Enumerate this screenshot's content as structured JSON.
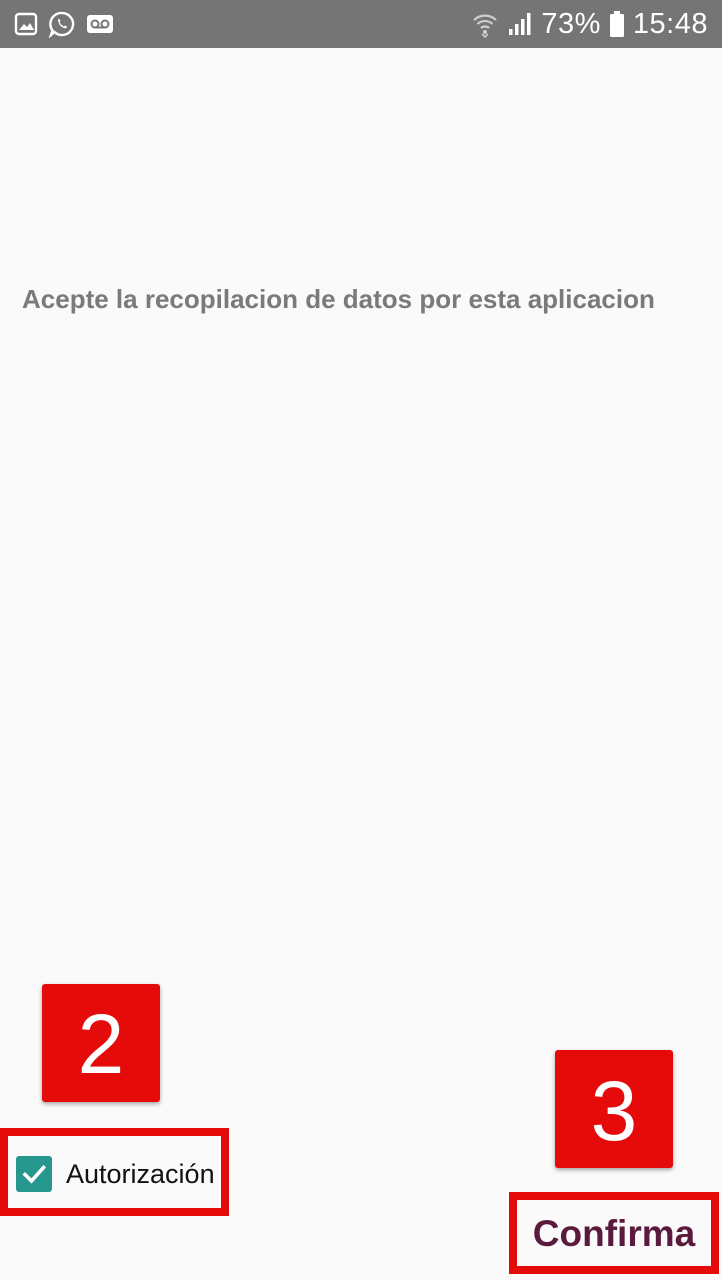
{
  "status_bar": {
    "battery_percent": "73%",
    "time": "15:48",
    "left_icons": [
      "gallery-icon",
      "whatsapp-icon",
      "voicemail-icon"
    ],
    "right_icons": [
      "wifi-icon",
      "signal-icon",
      "battery-icon"
    ]
  },
  "content": {
    "message": "Acepte la recopilacion de datos por esta aplicacion"
  },
  "consent": {
    "checkbox_label": "Autorización",
    "checked": true
  },
  "actions": {
    "confirm_label": "Confirma"
  },
  "annotations": {
    "step_checkbox": "2",
    "step_confirm": "3"
  },
  "colors": {
    "status_bar": "#757575",
    "background": "#fafafa",
    "checkbox": "#26978c",
    "confirm_text": "#5a1a3d",
    "annotation": "#e60b0b",
    "message_text": "#7a7a7a"
  }
}
